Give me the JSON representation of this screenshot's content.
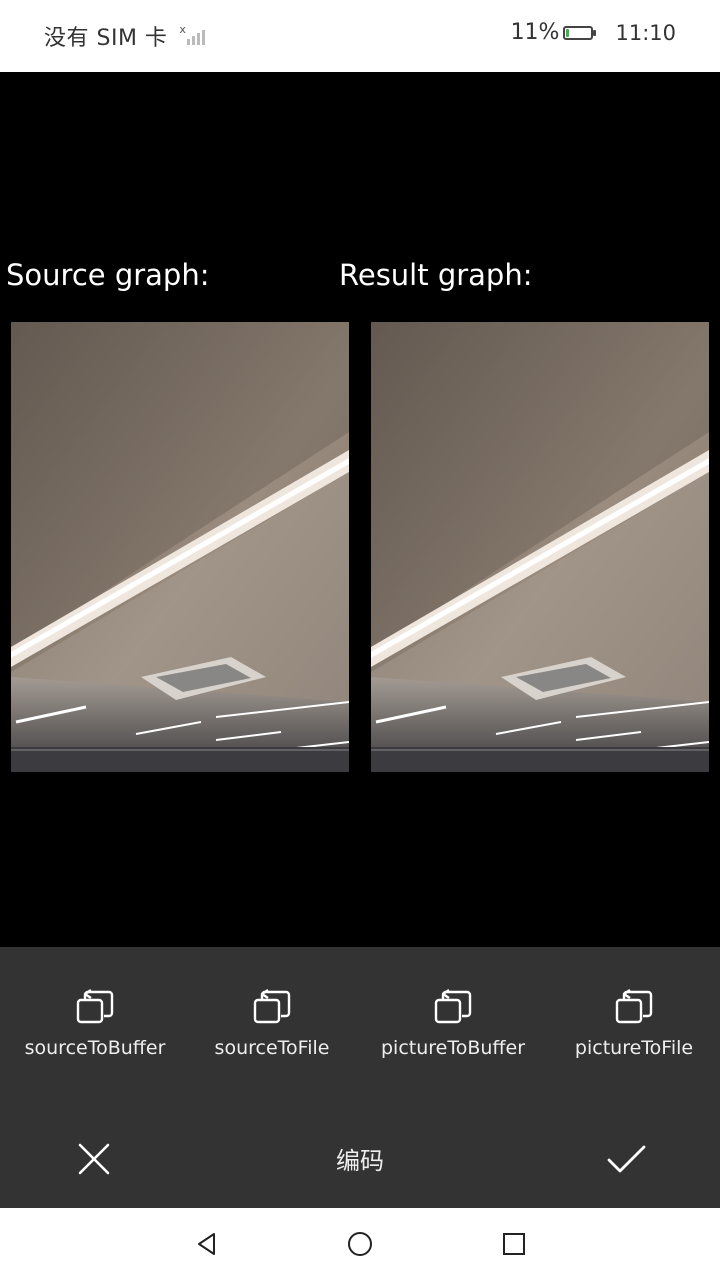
{
  "status_bar": {
    "carrier": "没有 SIM 卡",
    "battery_percent": "11%",
    "battery_level": 0.11,
    "time": "11:10",
    "battery_color": "#3cb34a"
  },
  "main": {
    "source_label": "Source graph:",
    "result_label": "Result graph:"
  },
  "actions": [
    {
      "label": "sourceToBuffer",
      "icon": "copy-icon"
    },
    {
      "label": "sourceToFile",
      "icon": "copy-icon"
    },
    {
      "label": "pictureToBuffer",
      "icon": "copy-icon"
    },
    {
      "label": "pictureToFile",
      "icon": "copy-icon"
    }
  ],
  "bottom_bar": {
    "title": "编码",
    "close_icon": "close-icon",
    "confirm_icon": "check-icon"
  },
  "navbar": {
    "back_icon": "triangle-back-icon",
    "home_icon": "circle-home-icon",
    "recent_icon": "square-recent-icon"
  },
  "colors": {
    "panel_bg": "#333333",
    "background": "#000000"
  }
}
